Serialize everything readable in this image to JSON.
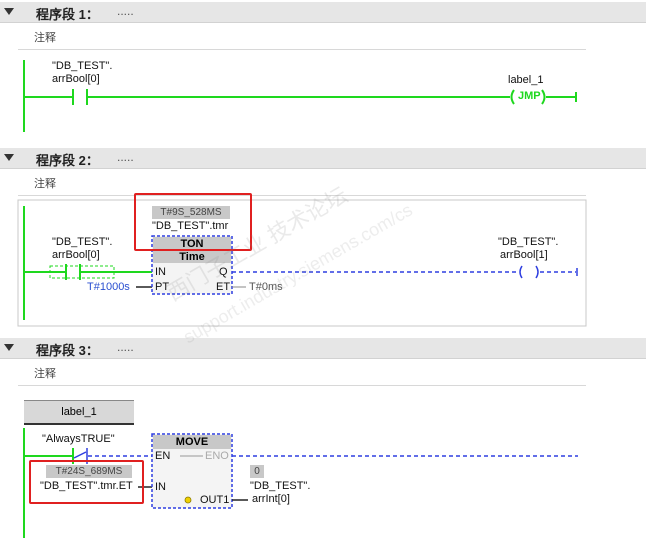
{
  "networks": [
    {
      "title": "程序段 1：",
      "dots": ".....",
      "comment": "注释"
    },
    {
      "title": "程序段 2：",
      "dots": ".....",
      "comment": "注释"
    },
    {
      "title": "程序段 3：",
      "dots": ".....",
      "comment": "注释"
    }
  ],
  "net1": {
    "contact_operand_1": "\"DB_TEST\".",
    "contact_operand_2": "arrBool[0]",
    "jump_label": "label_1",
    "jump_text": "JMP"
  },
  "net2": {
    "timer_value": "T#9S_528MS",
    "timer_instance": "\"DB_TEST\".tmr",
    "block_type": "TON",
    "block_subtype": "Time",
    "pin_in": "IN",
    "pin_q": "Q",
    "pin_pt": "PT",
    "pin_et": "ET",
    "pt_value": "T#1000s",
    "et_value": "T#0ms",
    "contact_operand_1": "\"DB_TEST\".",
    "contact_operand_2": "arrBool[0]",
    "coil_operand_1": "\"DB_TEST\".",
    "coil_operand_2": "arrBool[1]"
  },
  "net3": {
    "label": "label_1",
    "contact_operand": "\"AlwaysTRUE\"",
    "block_type": "MOVE",
    "pin_en": "EN",
    "pin_eno": "ENO",
    "pin_in": "IN",
    "pin_out": "OUT1",
    "in_value": "T#24S_689MS",
    "in_operand": "\"DB_TEST\".tmr.ET",
    "out_value": "0",
    "out_operand_1": "\"DB_TEST\".",
    "out_operand_2": "arrInt[0]"
  },
  "watermark": {
    "line1": "西门子工业  技术论坛",
    "line2": "support.industry.siemens.com/cs"
  },
  "colors": {
    "energized": "#1ed81e",
    "unpowered": "#2f3fe0",
    "highlight": "#e02020"
  }
}
